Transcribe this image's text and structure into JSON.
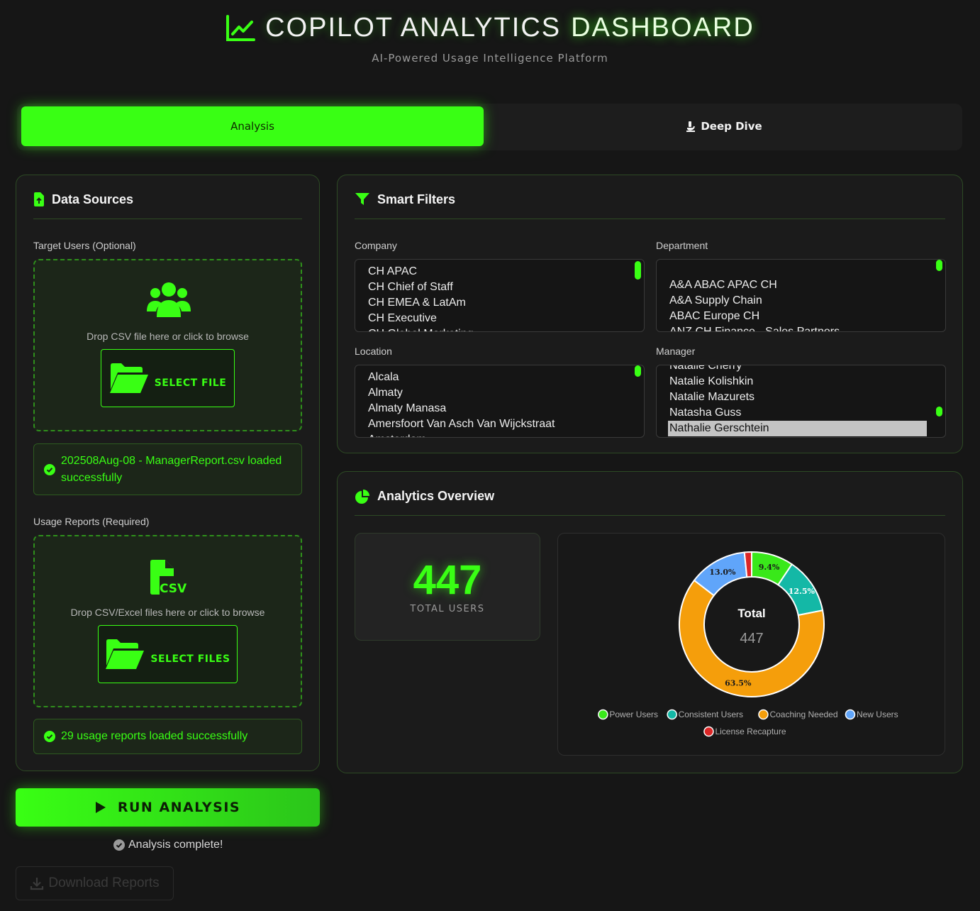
{
  "header": {
    "title_main": "COPILOT ANALYTICS",
    "title_accent": "DASHBOARD",
    "subtitle": "AI-Powered Usage Intelligence Platform"
  },
  "tabs": [
    {
      "label": "Analysis",
      "active": true
    },
    {
      "label": "Deep Dive",
      "active": false
    }
  ],
  "data_sources": {
    "title": "Data Sources",
    "target_users": {
      "label": "Target Users (Optional)",
      "drop_text": "Drop CSV file here or click to browse",
      "button": "SELECT FILE",
      "status": "202508Aug-08 - ManagerReport.csv loaded successfully"
    },
    "usage_reports": {
      "label": "Usage Reports (Required)",
      "drop_text": "Drop CSV/Excel files here or click to browse",
      "button": "SELECT FILES",
      "status": "29 usage reports loaded successfully"
    }
  },
  "actions": {
    "run_label": "RUN ANALYSIS",
    "complete_text": "Analysis complete!",
    "download_label": "Download Reports"
  },
  "filters": {
    "title": "Smart Filters",
    "company": {
      "label": "Company",
      "options": [
        "CH APAC",
        "CH Chief of Staff",
        "CH EMEA & LatAm",
        "CH Executive",
        "CH Global Marketing"
      ]
    },
    "department": {
      "label": "Department",
      "options": [
        "",
        "A&A ABAC APAC CH",
        "A&A Supply Chain",
        "ABAC Europe CH",
        "ANZ CH Finance - Sales Partners"
      ]
    },
    "location": {
      "label": "Location",
      "options": [
        "Alcala",
        "Almaty",
        "Almaty Manasa",
        "Amersfoort Van Asch Van Wijckstraat",
        "Amsterdam"
      ]
    },
    "manager": {
      "label": "Manager",
      "options": [
        "Natalie Cherry",
        "Natalie Kolishkin",
        "Natalie Mazurets",
        "Natasha Guss",
        "Nathalie Gerschtein"
      ],
      "selected": "Nathalie Gerschtein"
    }
  },
  "overview": {
    "title": "Analytics Overview",
    "total_users": "447",
    "total_users_label": "TOTAL USERS"
  },
  "chart_data": {
    "type": "pie",
    "donut": true,
    "center_label": "Total",
    "center_value": "447",
    "legend_position": "bottom",
    "categories": [
      "Power Users",
      "Consistent Users",
      "Coaching Needed",
      "New Users",
      "License Recapture"
    ],
    "values": [
      9.4,
      12.5,
      63.5,
      13.0,
      1.6
    ],
    "labels": [
      "9.4%",
      "12.5%",
      "63.5%",
      "13.0%",
      ""
    ],
    "colors": [
      "#39e81a",
      "#14b8a6",
      "#f59e0b",
      "#60a5fa",
      "#dc2626"
    ]
  }
}
